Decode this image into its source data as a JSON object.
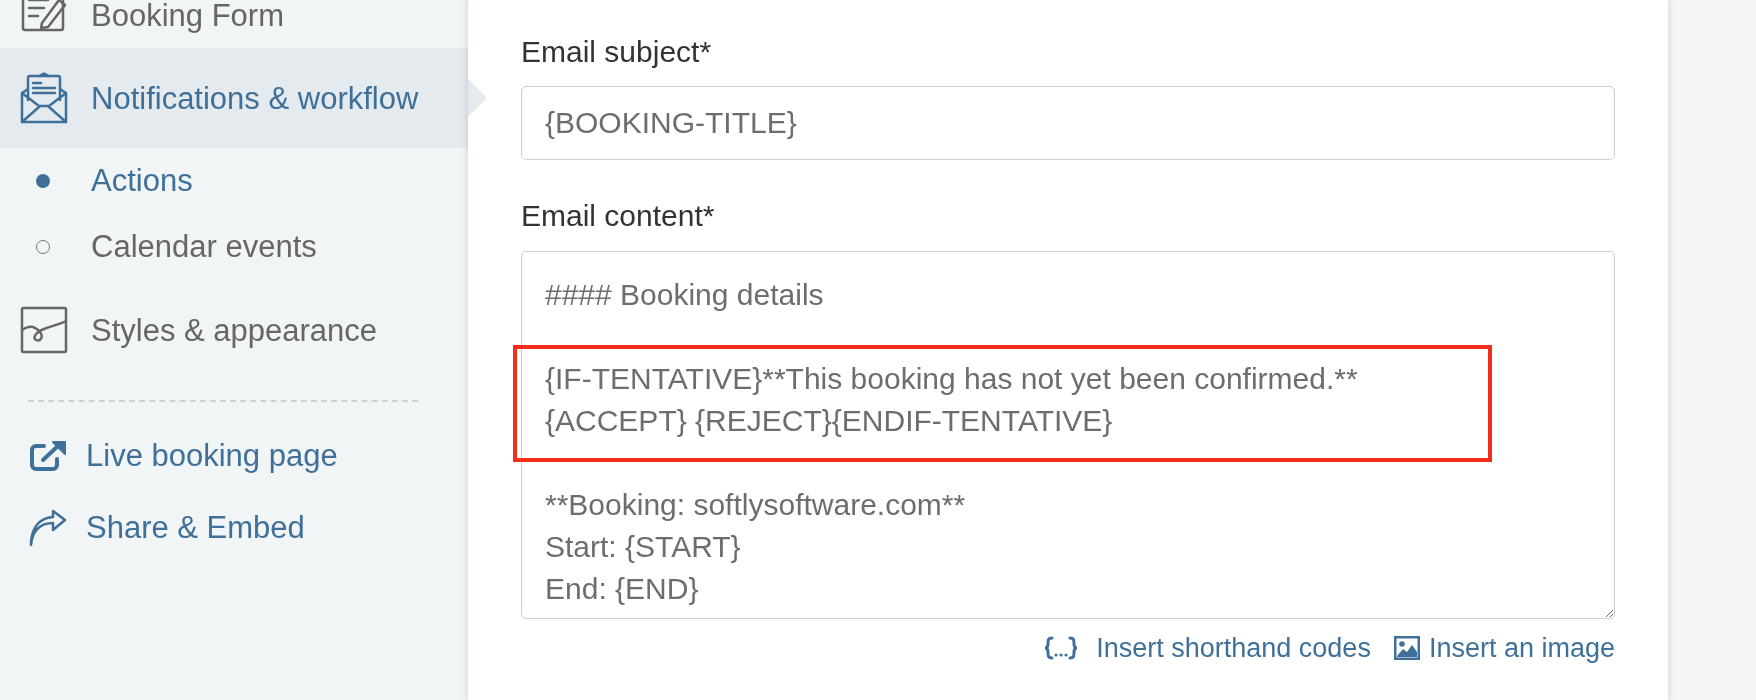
{
  "sidebar": {
    "sections": [
      {
        "label": "Booking Form",
        "selected": false
      },
      {
        "label": "Notifications & workflow",
        "selected": true,
        "children": [
          {
            "label": "Actions",
            "selected": true
          },
          {
            "label": "Calendar events",
            "selected": false
          }
        ]
      },
      {
        "label": "Styles & appearance",
        "selected": false
      }
    ],
    "links": [
      {
        "label": "Live booking page"
      },
      {
        "label": "Share & Embed"
      }
    ]
  },
  "form": {
    "fields": [
      {
        "kind": "input",
        "label": "Email subject*",
        "value": "{BOOKING-TITLE}"
      },
      {
        "kind": "textarea",
        "label": "Email content*",
        "value": "#### Booking details\n\n{IF-TENTATIVE}**This booking has not yet been confirmed.**\n{ACCEPT} {REJECT}{ENDIF-TENTATIVE}\n\n**Booking: softlysoftware.com**\nStart: {START}\nEnd: {END}"
      }
    ],
    "tools": [
      {
        "label": "Insert shorthand codes"
      },
      {
        "label": "Insert an image"
      }
    ]
  }
}
